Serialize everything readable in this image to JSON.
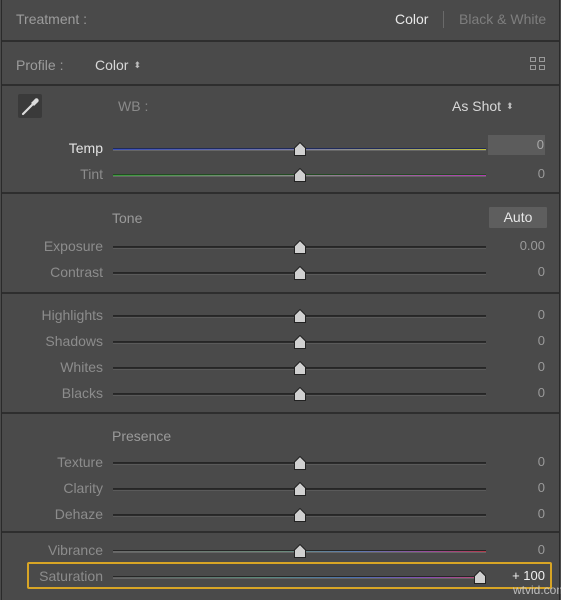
{
  "treatment": {
    "label": "Treatment :",
    "options": [
      "Color",
      "Black & White"
    ],
    "selected": "Color"
  },
  "profile": {
    "label": "Profile :",
    "value": "Color",
    "browser_icon": "grid-icon"
  },
  "wb": {
    "picker_icon": "eyedropper-icon",
    "label": "WB :",
    "value": "As Shot"
  },
  "sliders": {
    "temp": {
      "label": "Temp",
      "value": "0",
      "position": 0.5
    },
    "tint": {
      "label": "Tint",
      "value": "0",
      "position": 0.5
    },
    "exposure": {
      "label": "Exposure",
      "value": "0.00",
      "position": 0.5
    },
    "contrast": {
      "label": "Contrast",
      "value": "0",
      "position": 0.5
    },
    "highlights": {
      "label": "Highlights",
      "value": "0",
      "position": 0.5
    },
    "shadows": {
      "label": "Shadows",
      "value": "0",
      "position": 0.5
    },
    "whites": {
      "label": "Whites",
      "value": "0",
      "position": 0.5
    },
    "blacks": {
      "label": "Blacks",
      "value": "0",
      "position": 0.5
    },
    "texture": {
      "label": "Texture",
      "value": "0",
      "position": 0.5
    },
    "clarity": {
      "label": "Clarity",
      "value": "0",
      "position": 0.5
    },
    "dehaze": {
      "label": "Dehaze",
      "value": "0",
      "position": 0.5
    },
    "vibrance": {
      "label": "Vibrance",
      "value": "0",
      "position": 0.5
    },
    "saturation": {
      "label": "Saturation",
      "value": "+ 100",
      "position": 1.0
    }
  },
  "tone": {
    "title": "Tone",
    "auto_label": "Auto"
  },
  "presence": {
    "title": "Presence"
  },
  "colors": {
    "panel_bg": "#4a4a4a",
    "highlight": "#d8a525",
    "thumb": "#d0d0d0"
  },
  "watermark": "wtvid.com"
}
